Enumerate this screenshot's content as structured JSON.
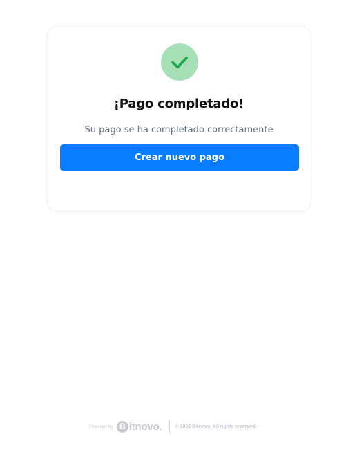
{
  "status": {
    "icon": "check-icon",
    "title": "¡Pago completado!",
    "message": "Su pago se ha completado correctamente",
    "badge_color": "#a6dfb6",
    "check_color": "#1aa64a"
  },
  "actions": {
    "new_payment_label": "Crear nuevo pago",
    "button_color": "#0a7cff"
  },
  "footer": {
    "powered_by": "Powered by",
    "logo_coin": "B",
    "logo_text": "itnovo.",
    "copyright": "© 2022 Bitnovo. All rights reserved."
  }
}
